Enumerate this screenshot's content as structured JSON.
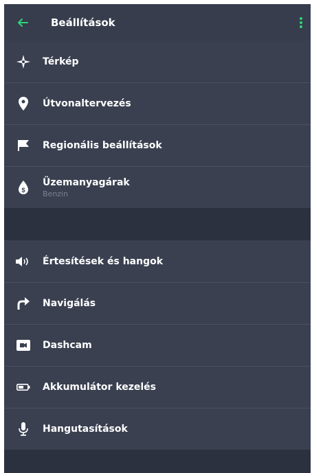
{
  "header": {
    "title": "Beállítások",
    "back_icon": "arrow-left-icon",
    "more_icon": "more-vertical-icon",
    "accent_color": "#2ed47a"
  },
  "group1": [
    {
      "label": "Térkép",
      "icon": "compass-rose-icon"
    },
    {
      "label": "Útvonaltervezés",
      "icon": "map-pin-icon"
    },
    {
      "label": "Regionális beállítások",
      "icon": "flag-icon"
    },
    {
      "label": "Üzemanyagárak",
      "sublabel": "Benzin",
      "icon": "fuel-price-icon"
    }
  ],
  "group2": [
    {
      "label": "Értesítések és hangok",
      "icon": "speaker-icon"
    },
    {
      "label": "Navigálás",
      "icon": "turn-right-arrow-icon"
    },
    {
      "label": "Dashcam",
      "icon": "camera-icon"
    },
    {
      "label": "Akkumulátor kezelés",
      "icon": "battery-icon"
    },
    {
      "label": "Hangutasítások",
      "icon": "microphone-icon"
    }
  ]
}
